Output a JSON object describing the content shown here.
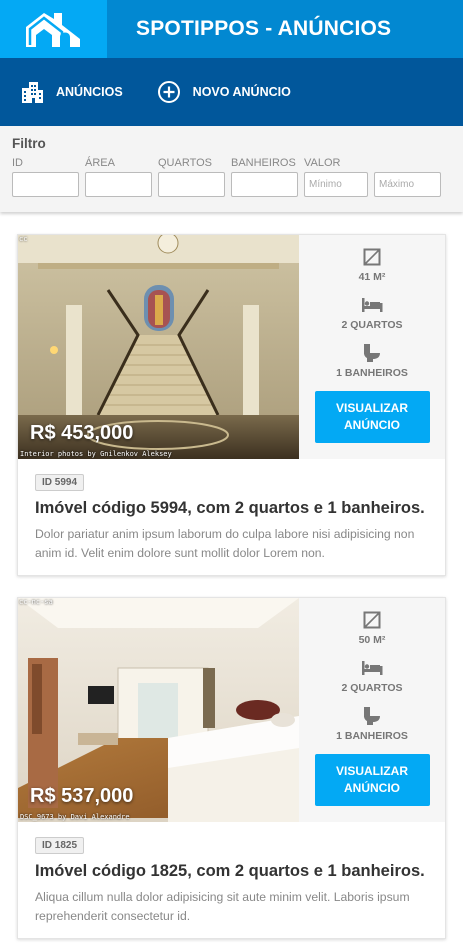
{
  "header": {
    "title": "SPOTIPPOS - ANÚNCIOS"
  },
  "nav": {
    "items": [
      {
        "label": "ANÚNCIOS",
        "icon": "building-icon"
      },
      {
        "label": "NOVO ANÚNCIO",
        "icon": "plus-circle-icon"
      }
    ]
  },
  "filter": {
    "title": "Filtro",
    "fields": {
      "id": {
        "label": "ID",
        "value": "",
        "placeholder": ""
      },
      "area": {
        "label": "ÁREA",
        "value": "",
        "placeholder": ""
      },
      "quartos": {
        "label": "QUARTOS",
        "value": "",
        "placeholder": ""
      },
      "banheiros": {
        "label": "BANHEIROS",
        "value": "",
        "placeholder": ""
      },
      "valor_min": {
        "label": "VALOR",
        "value": "",
        "placeholder": "Mínimo"
      },
      "valor_max": {
        "label": "",
        "value": "",
        "placeholder": "Máximo"
      }
    }
  },
  "listings": [
    {
      "price": "R$ 453,000",
      "credit": "Interior photos by Gnilenkov Aleksey",
      "license": "cc",
      "area": "41 M²",
      "quartos": "2 QUARTOS",
      "banheiros": "1 BANHEIROS",
      "button": "VISUALIZAR\nANÚNCIO",
      "id": "ID 5994",
      "title": "Imóvel código 5994, com 2 quartos e 1 banheiros.",
      "description": "Dolor pariatur anim ipsum laborum do culpa labore nisi adipisicing non anim id. Velit enim dolore sunt mollit dolor Lorem non."
    },
    {
      "price": "R$ 537,000",
      "credit": "DSC_9673 by Davi Alexandre",
      "license": "cc-nc-sa",
      "area": "50 M²",
      "quartos": "2 QUARTOS",
      "banheiros": "1 BANHEIROS",
      "button": "VISUALIZAR\nANÚNCIO",
      "id": "ID 1825",
      "title": "Imóvel código 1825, com 2 quartos e 1 banheiros.",
      "description": "Aliqua cillum nulla dolor adipisicing sit aute minim velit. Laboris ipsum reprehenderit consectetur id."
    }
  ],
  "colors": {
    "logo_bg": "#04a9f4",
    "title_bg": "#0288d1",
    "nav_bg": "#01579b",
    "button_bg": "#03a9f4"
  }
}
